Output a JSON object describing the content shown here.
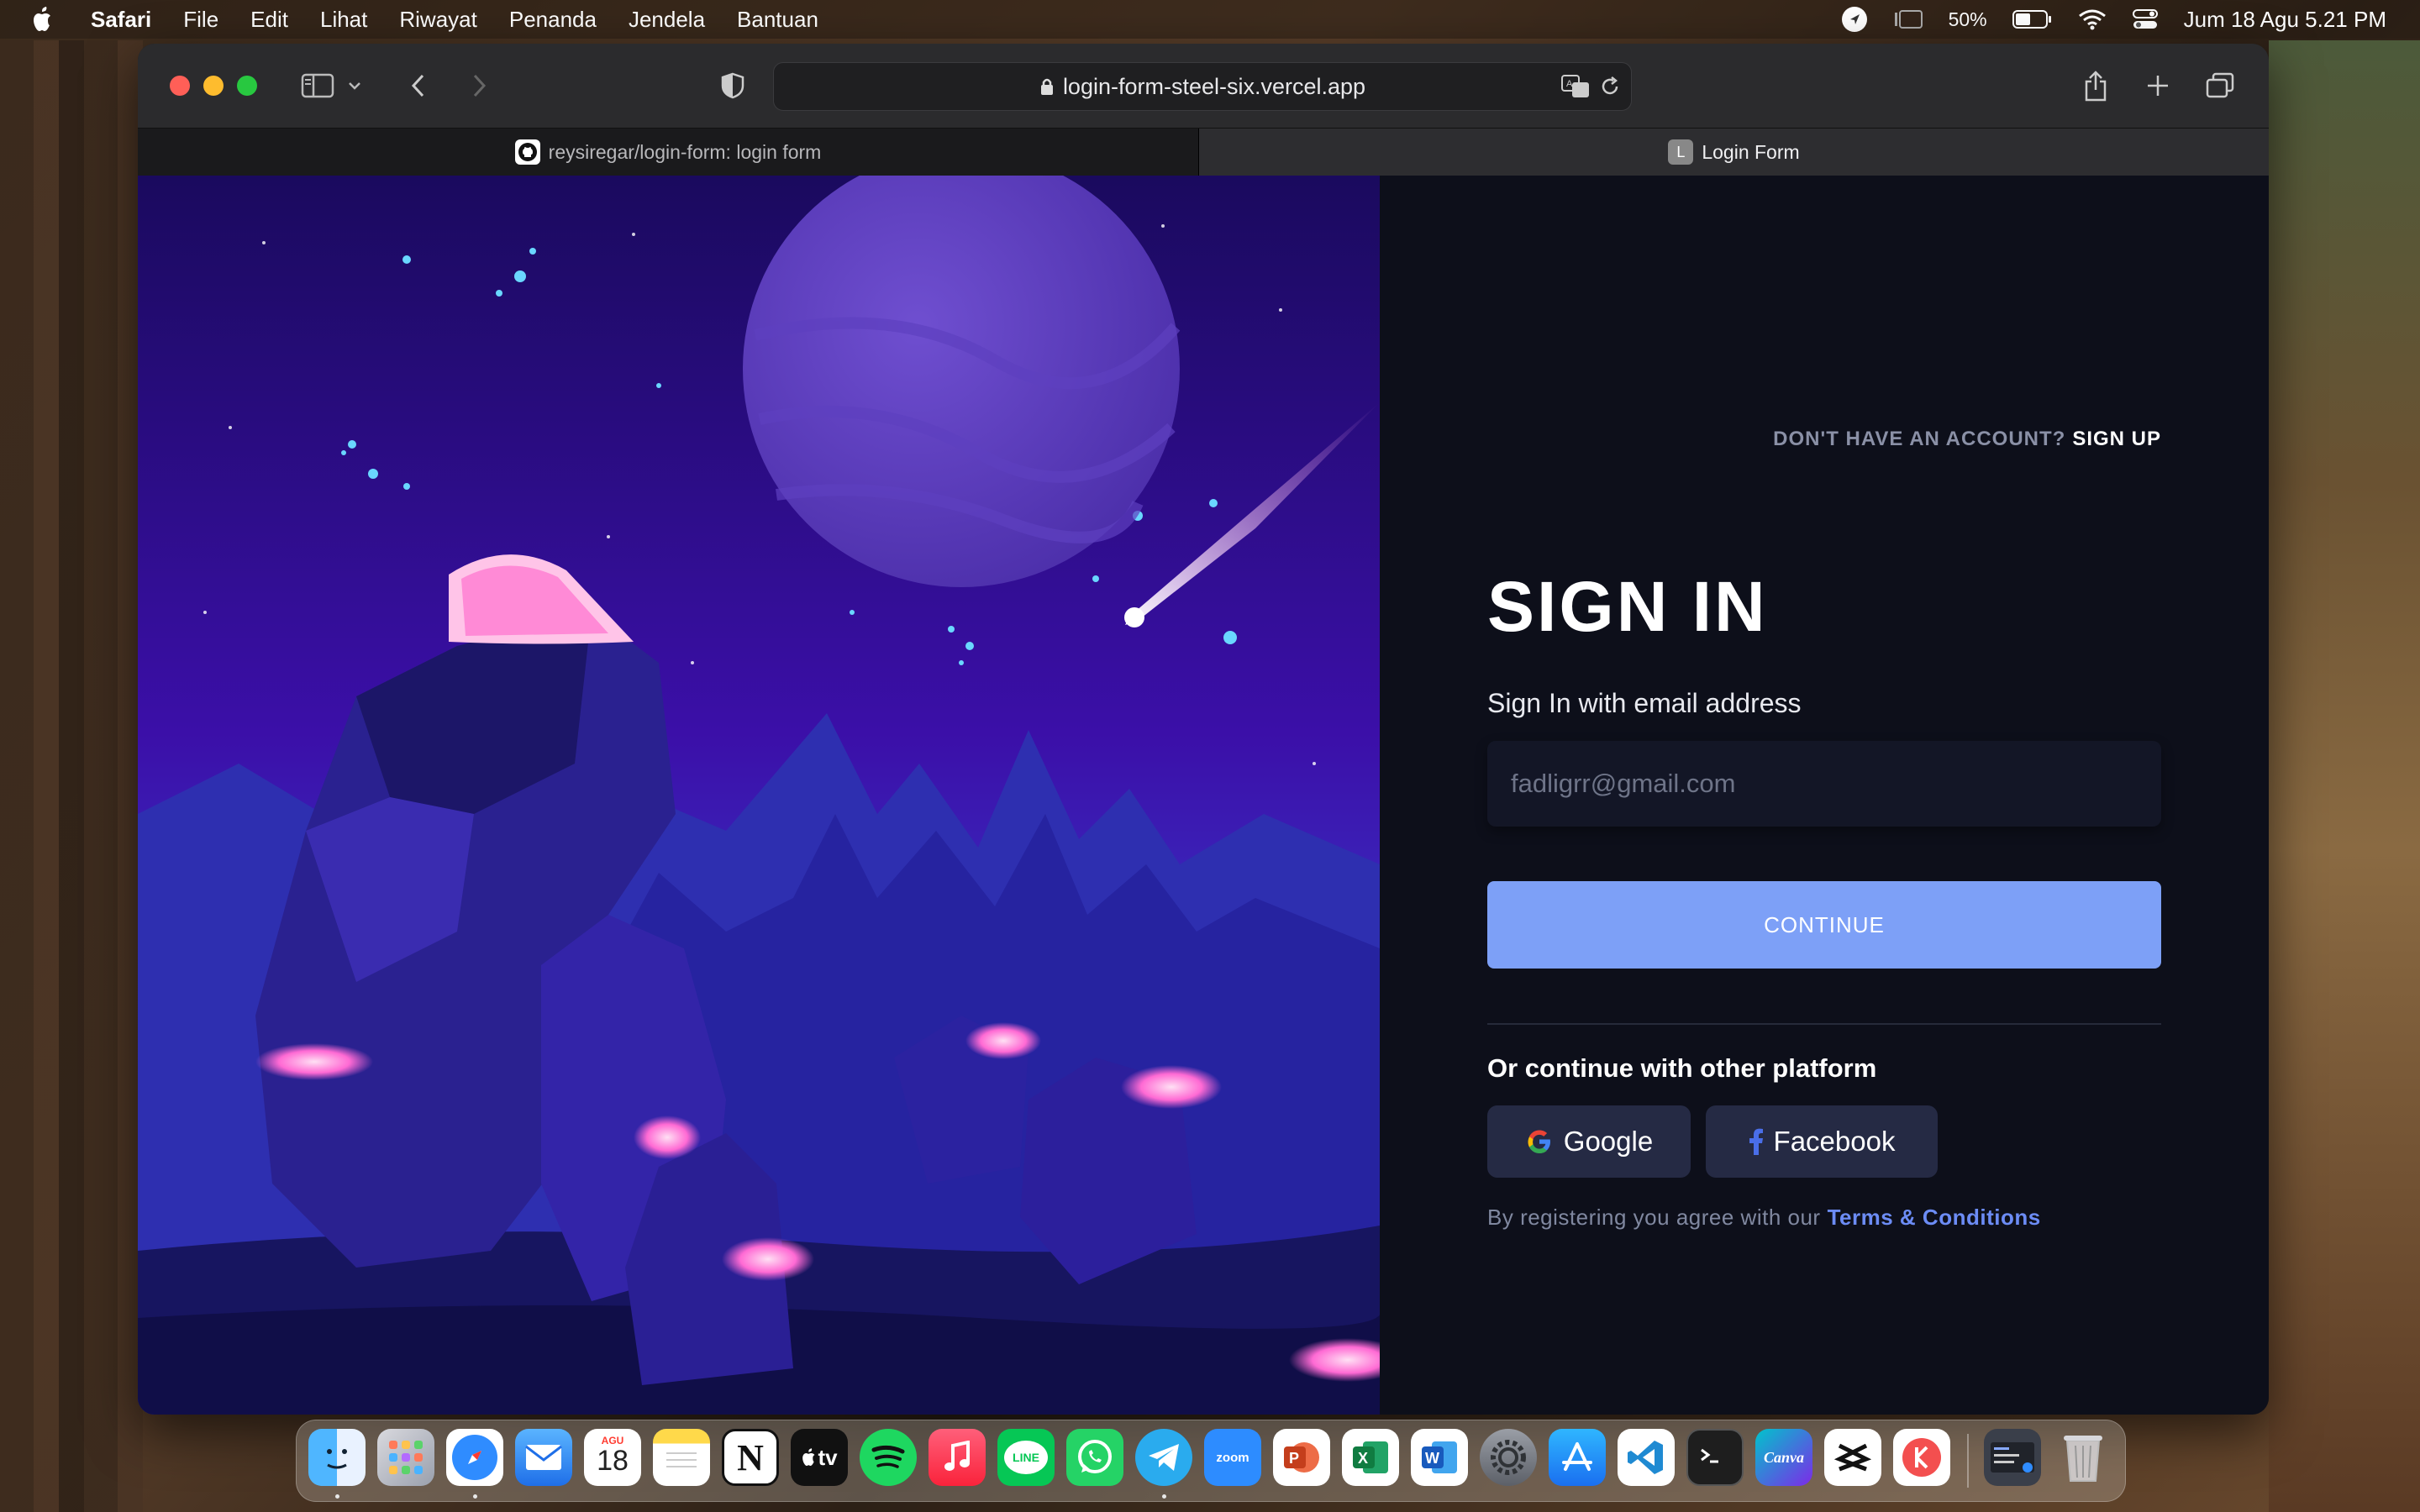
{
  "menubar": {
    "app": "Safari",
    "items": [
      "File",
      "Edit",
      "Lihat",
      "Riwayat",
      "Penanda",
      "Jendela",
      "Bantuan"
    ],
    "battery": "50%",
    "datetime": "Jum 18 Agu  5.21 PM"
  },
  "browser": {
    "url": "login-form-steel-six.vercel.app",
    "tabs": [
      {
        "label": "reysiregar/login-form: login form",
        "favicon": "github-icon",
        "active": false
      },
      {
        "label": "Login Form",
        "favicon_letter": "L",
        "active": true
      }
    ]
  },
  "login": {
    "signup_prompt": "DON'T HAVE AN ACCOUNT?",
    "signup_link": "SIGN UP",
    "title": "SIGN IN",
    "subtitle": "Sign In with email address",
    "email_placeholder": "fadligrr@gmail.com",
    "continue_label": "CONTINUE",
    "alt_label": "Or continue with other platform",
    "google_label": "Google",
    "facebook_label": "Facebook",
    "terms_text": "By registering you agree with our",
    "terms_link": "Terms & Conditions"
  },
  "dock": {
    "calendar_month": "AGU",
    "calendar_day": "18",
    "tv_label": "tv",
    "zoom_label": "zoom",
    "line_label": "LINE",
    "canva_label": "Canva",
    "notion_label": "N"
  },
  "colors": {
    "accent": "#7da0f7",
    "link": "#6c8cf5",
    "panel_bg": "#0d0f1a",
    "social_bg": "#252a44"
  }
}
